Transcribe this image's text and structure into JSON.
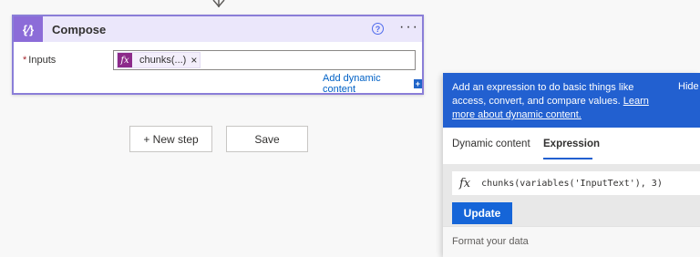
{
  "compose": {
    "title": "Compose",
    "icon": "curly-braces-icon",
    "icon_text": "{⁄}",
    "help_glyph": "?",
    "more_glyph": "···",
    "inputs_required_mark": "*",
    "inputs_label": "Inputs",
    "token": {
      "fx_glyph": "fx",
      "label": "chunks(...)",
      "remove_glyph": "×"
    },
    "add_dynamic_label": "Add dynamic content",
    "add_dynamic_glyph": "+"
  },
  "actions": {
    "new_step_label": "+ New step",
    "save_label": "Save"
  },
  "panel": {
    "banner_text": "Add an expression to do basic things like access, convert, and compare values.",
    "banner_link": "Learn more about dynamic content.",
    "hide_label": "Hide",
    "tabs": [
      {
        "label": "Dynamic content",
        "active": false
      },
      {
        "label": "Expression",
        "active": true
      }
    ],
    "expression_fx": "fx",
    "expression_value": "chunks(variables('InputText'), 3)",
    "update_label": "Update",
    "format_label": "Format your data"
  },
  "colors": {
    "accent": "#2260d0",
    "compose_icon_bg": "#8c6cd8",
    "compose_header_bg": "#ebe7fb",
    "token_fx_bg": "#8c2a8a"
  }
}
